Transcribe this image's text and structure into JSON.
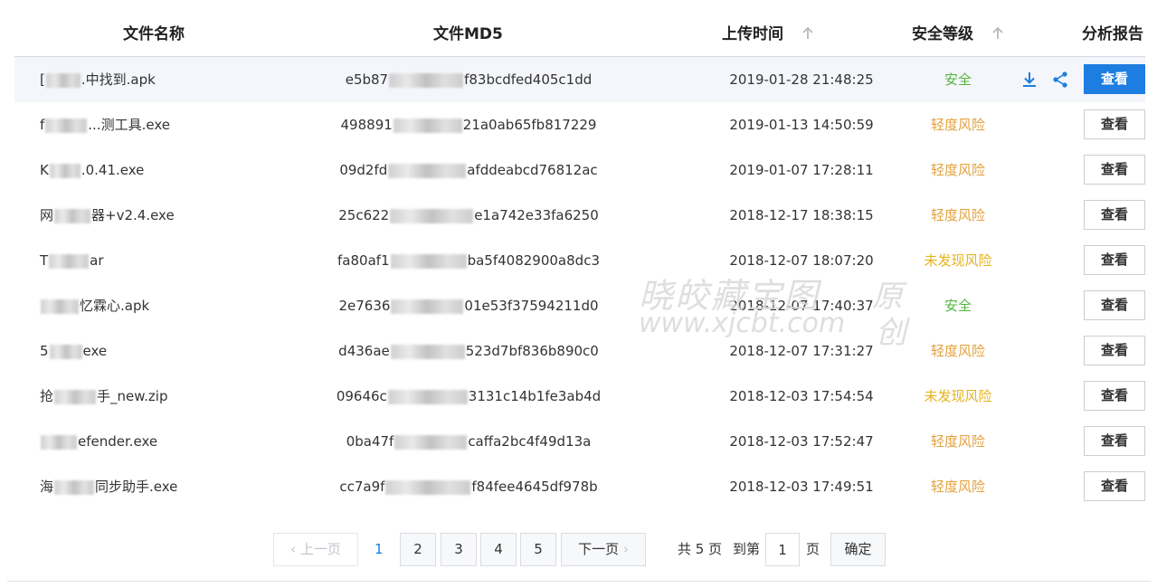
{
  "table": {
    "headers": {
      "name": "文件名称",
      "md5": "文件MD5",
      "time": "上传时间",
      "level": "安全等级",
      "report": "分析报告"
    },
    "view_label": "查看",
    "rows": [
      {
        "name_pre": "[",
        "name_post": ".中找到.apk",
        "md5_pre": "e5b87",
        "md5_post": "f83bcdfed405c1dd",
        "time": "2019-01-28 21:48:25",
        "level": "安全",
        "level_type": "safe"
      },
      {
        "name_pre": "f",
        "name_post": "...测工具.exe",
        "md5_pre": "498891",
        "md5_post": "21a0ab65fb817229",
        "time": "2019-01-13 14:50:59",
        "level": "轻度风险",
        "level_type": "low"
      },
      {
        "name_pre": "K",
        "name_post": ".0.41.exe",
        "md5_pre": "09d2fd",
        "md5_post": "afddeabcd76812ac",
        "time": "2019-01-07 17:28:11",
        "level": "轻度风险",
        "level_type": "low"
      },
      {
        "name_pre": "网",
        "name_post": "器+v2.4.exe",
        "md5_pre": "25c622",
        "md5_post": "e1a742e33fa6250",
        "time": "2018-12-17 18:38:15",
        "level": "轻度风险",
        "level_type": "low"
      },
      {
        "name_pre": "T",
        "name_post": "ar",
        "md5_pre": "fa80af1",
        "md5_post": "ba5f4082900a8dc3",
        "time": "2018-12-07 18:07:20",
        "level": "未发现风险",
        "level_type": "unknown"
      },
      {
        "name_pre": "",
        "name_post": "忆霖心.apk",
        "md5_pre": "2e7636",
        "md5_post": "01e53f37594211d0",
        "time": "2018-12-07 17:40:37",
        "level": "安全",
        "level_type": "safe"
      },
      {
        "name_pre": "5",
        "name_post": "exe",
        "md5_pre": "d436ae",
        "md5_post": "523d7bf836b890c0",
        "time": "2018-12-07 17:31:27",
        "level": "轻度风险",
        "level_type": "low"
      },
      {
        "name_pre": "抢",
        "name_post": "手_new.zip",
        "md5_pre": "09646c",
        "md5_post": "3131c14b1fe3ab4d",
        "time": "2018-12-03 17:54:54",
        "level": "未发现风险",
        "level_type": "unknown"
      },
      {
        "name_pre": "",
        "name_post": "efender.exe",
        "md5_pre": "0ba47f",
        "md5_post": "caffa2bc4f49d13a",
        "time": "2018-12-03 17:52:47",
        "level": "轻度风险",
        "level_type": "low"
      },
      {
        "name_pre": "海",
        "name_post": "同步助手.exe",
        "md5_pre": "cc7a9f",
        "md5_post": "f84fee4645df978b",
        "time": "2018-12-03 17:49:51",
        "level": "轻度风险",
        "level_type": "low"
      }
    ]
  },
  "pagination": {
    "prev_label": "上一页",
    "next_label": "下一页",
    "current_page": "1",
    "pages": [
      "2",
      "3",
      "4",
      "5"
    ],
    "total_text": "共 5 页",
    "goto_text": "到第",
    "page_unit": "页",
    "goto_value": "1",
    "confirm_label": "确定"
  },
  "watermark": {
    "line1": "晓皎藏宝图",
    "line2": "www.xjcbt.com",
    "side1": "原",
    "side2": "创"
  },
  "colors": {
    "accent": "#1d7de0",
    "safe": "#55b441",
    "low": "#e2a13c",
    "unknown": "#e6b21a"
  }
}
